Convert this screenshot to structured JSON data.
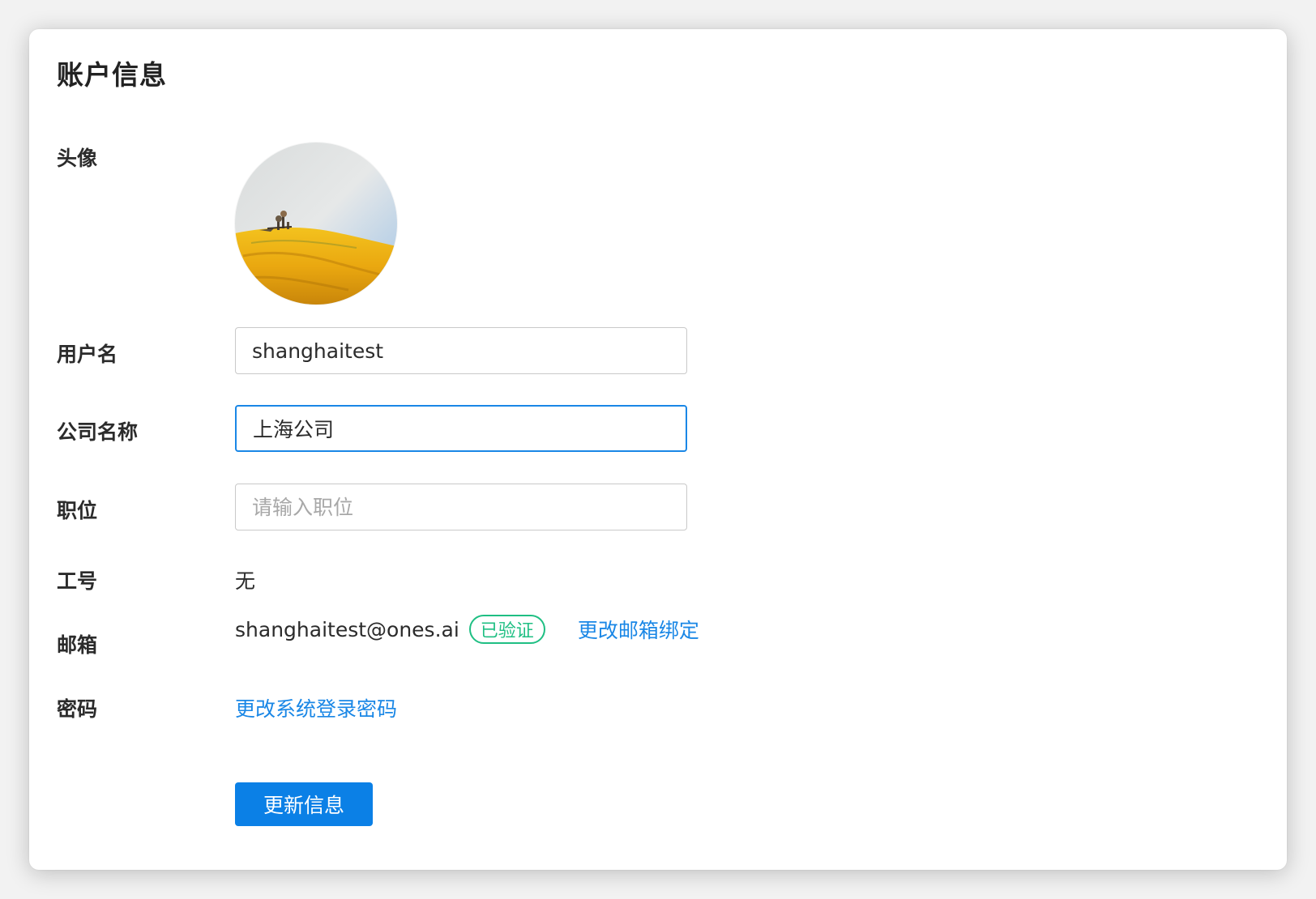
{
  "page": {
    "title": "账户信息"
  },
  "form": {
    "avatar_label": "头像",
    "username": {
      "label": "用户名",
      "value": "shanghaitest"
    },
    "company": {
      "label": "公司名称",
      "value": "上海公司"
    },
    "position": {
      "label": "职位",
      "value": "",
      "placeholder": "请输入职位"
    },
    "employee_id": {
      "label": "工号",
      "value": "无"
    },
    "email": {
      "label": "邮箱",
      "value": "shanghaitest@ones.ai",
      "verified_badge": "已验证",
      "change_link": "更改邮箱绑定"
    },
    "password": {
      "label": "密码",
      "change_link": "更改系统登录密码"
    },
    "submit_label": "更新信息"
  },
  "colors": {
    "accent": "#0b80e6",
    "link": "#1a87e6",
    "verified": "#1fbf83"
  }
}
